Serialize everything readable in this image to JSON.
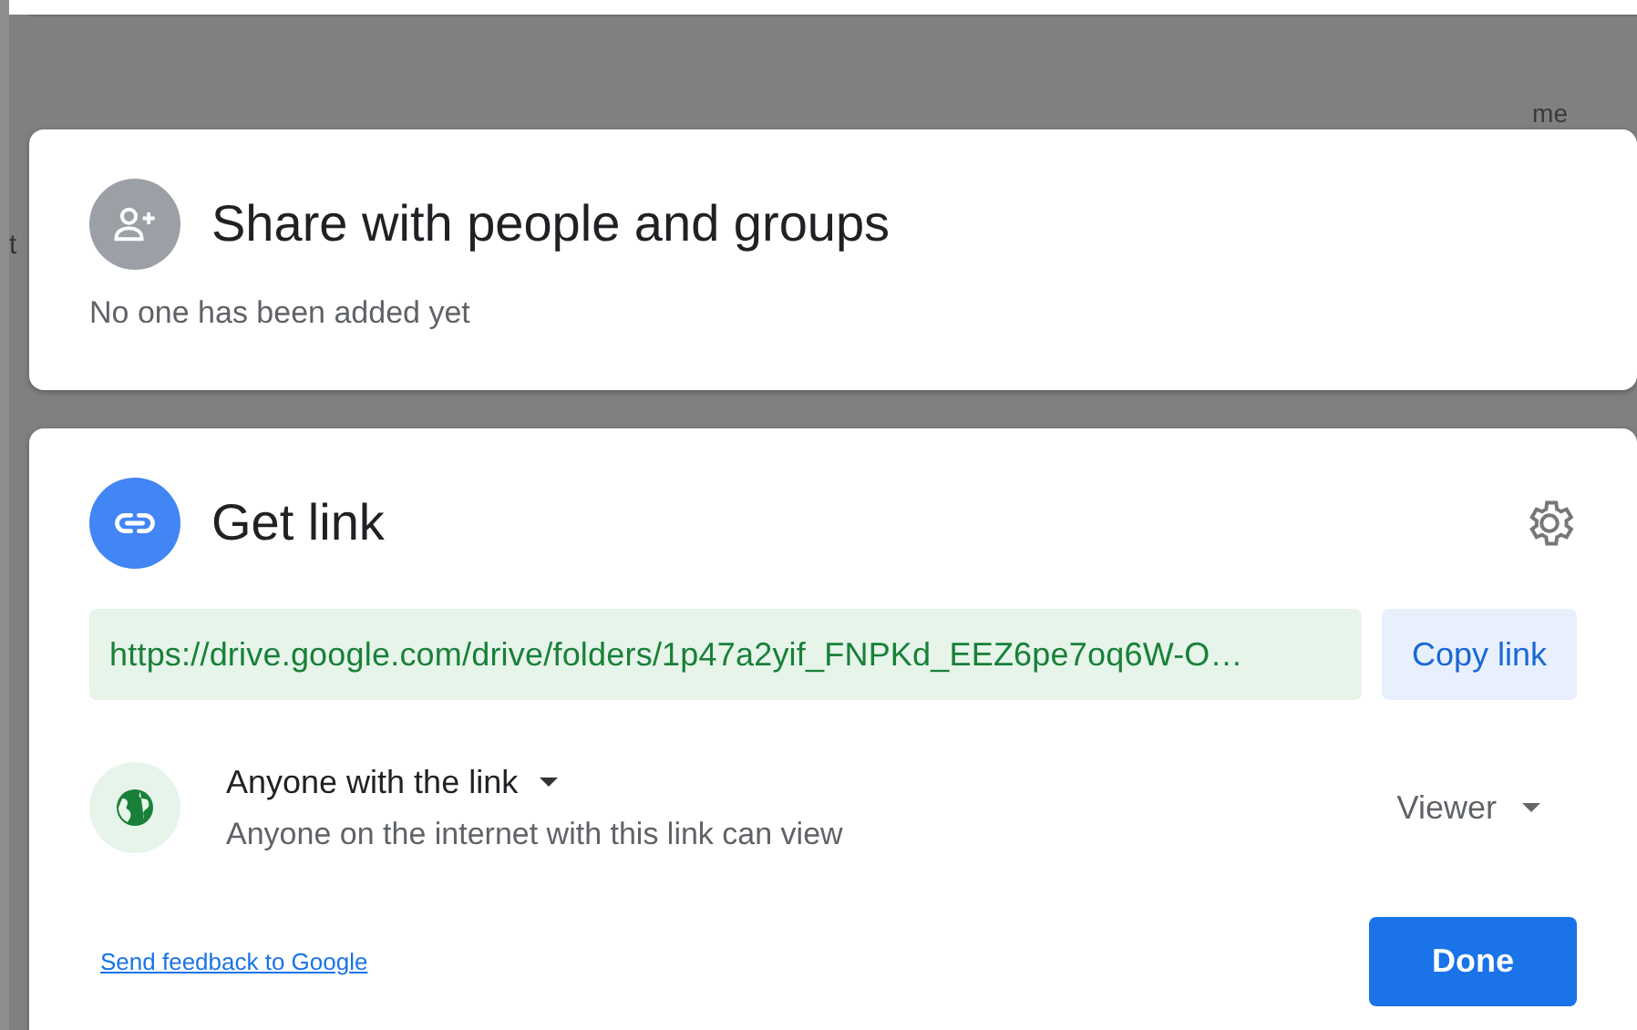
{
  "background": {
    "texts": [
      "me",
      "t"
    ]
  },
  "share": {
    "title": "Share with people and groups",
    "subtitle": "No one has been added yet"
  },
  "get_link": {
    "title": "Get link",
    "url": "https://drive.google.com/drive/folders/1p47a2yif_FNPKd_EEZ6pe7oq6W-O…",
    "copy_button": "Copy link",
    "access": {
      "scope": "Anyone with the link",
      "description": "Anyone on the internet with this link can view",
      "role": "Viewer"
    },
    "feedback_link": "Send feedback to Google",
    "done_button": "Done"
  }
}
